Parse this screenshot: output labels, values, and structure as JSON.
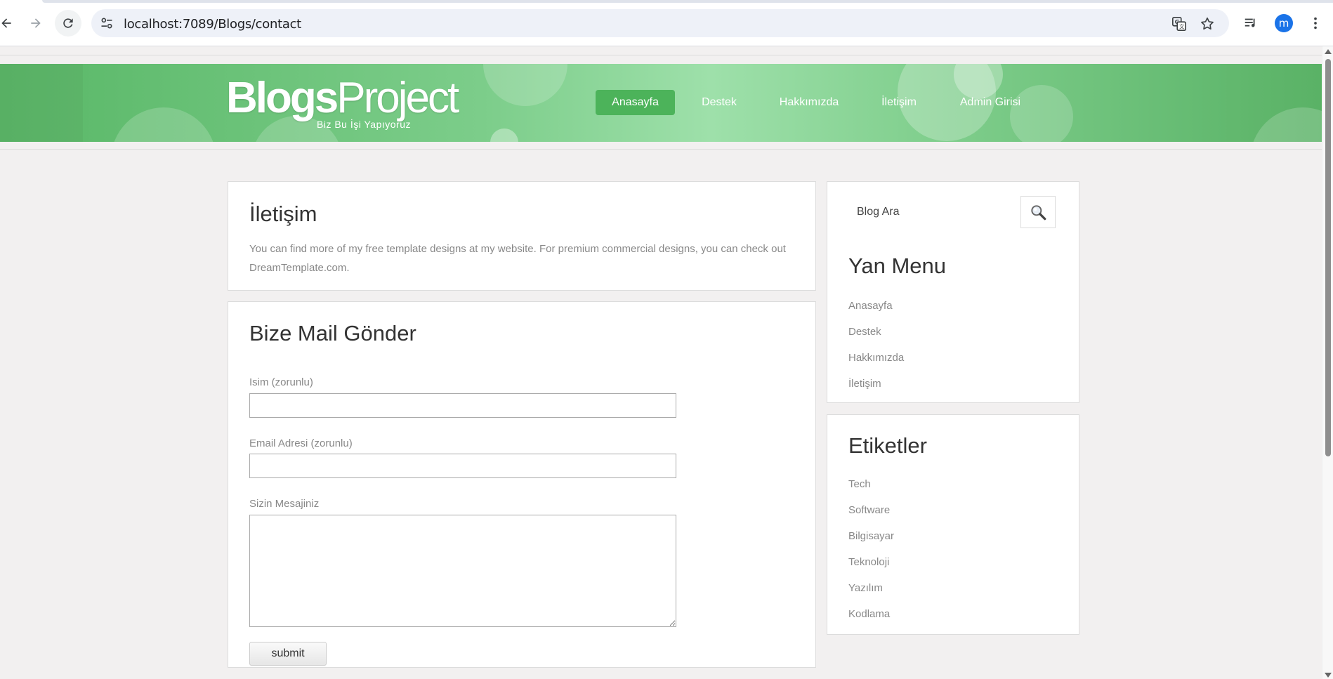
{
  "browser": {
    "url": "localhost:7089/Blogs/contact",
    "profile_initial": "m",
    "icons": [
      "back-arrow-icon",
      "forward-arrow-icon",
      "reload-icon",
      "site-info-icon",
      "translate-icon",
      "star-icon",
      "media-control-icon",
      "kebab-menu-icon"
    ]
  },
  "header": {
    "logo_bold": "Blogs",
    "logo_light": "Project",
    "tagline": "Biz Bu İşi Yapıyoruz",
    "nav": [
      {
        "label": "Anasayfa",
        "active": true
      },
      {
        "label": "Destek",
        "active": false
      },
      {
        "label": "Hakkımızda",
        "active": false
      },
      {
        "label": "İletişim",
        "active": false
      },
      {
        "label": "Admin Girisi",
        "active": false
      }
    ]
  },
  "intro": {
    "title": "İletişim",
    "text": "You can find more of my free template designs at my website. For premium commercial designs, you can check out DreamTemplate.com."
  },
  "form": {
    "title": "Bize Mail Gönder",
    "name_label": "Isim (zorunlu)",
    "email_label": "Email Adresi (zorunlu)",
    "message_label": "Sizin Mesajiniz",
    "submit_label": "submit"
  },
  "sidebar": {
    "search_placeholder": "Blog Ara",
    "menu_title": "Yan Menu",
    "menu_items": [
      "Anasayfa",
      "Destek",
      "Hakkımızda",
      "İletişim"
    ],
    "tags_title": "Etiketler",
    "tags": [
      "Tech",
      "Software",
      "Bilgisayar",
      "Teknoloji",
      "Yazılım",
      "Kodlama"
    ]
  },
  "colors": {
    "banner_green": "#6cc27a",
    "active_nav": "#4cb35a",
    "page_bg": "#f2f0f0"
  }
}
